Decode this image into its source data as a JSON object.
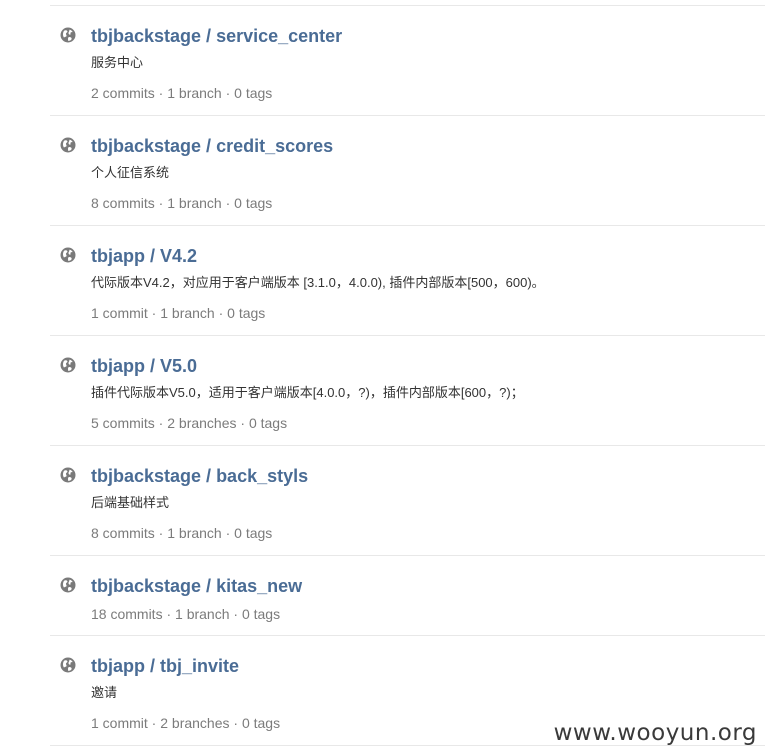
{
  "repos": [
    {
      "owner": "tbjbackstage",
      "separator": "/",
      "name": "service_center",
      "description": "服务中心",
      "meta": "2 commits · 1 branch · 0 tags",
      "icon": "globe-icon"
    },
    {
      "owner": "tbjbackstage",
      "separator": "/",
      "name": "credit_scores",
      "description": "个人征信系统",
      "meta": "8 commits · 1 branch · 0 tags",
      "icon": "globe-icon"
    },
    {
      "owner": "tbjapp",
      "separator": "/",
      "name": "V4.2",
      "description": "代际版本V4.2，对应用于客户端版本 [3.1.0，4.0.0), 插件内部版本[500，600)。",
      "meta": "1 commit · 1 branch · 0 tags",
      "icon": "globe-icon"
    },
    {
      "owner": "tbjapp",
      "separator": "/",
      "name": "V5.0",
      "description": "插件代际版本V5.0，适用于客户端版本[4.0.0，?)，插件内部版本[600，?)；",
      "meta": "5 commits · 2 branches · 0 tags",
      "icon": "globe-icon"
    },
    {
      "owner": "tbjbackstage",
      "separator": "/",
      "name": "back_styls",
      "description": "后端基础样式",
      "meta": "8 commits · 1 branch · 0 tags",
      "icon": "globe-icon"
    },
    {
      "owner": "tbjbackstage",
      "separator": "/",
      "name": "kitas_new",
      "description": "",
      "meta": "18 commits · 1 branch · 0 tags",
      "icon": "globe-icon"
    },
    {
      "owner": "tbjapp",
      "separator": "/",
      "name": "tbj_invite",
      "description": "邀请",
      "meta": "1 commit · 2 branches · 0 tags",
      "icon": "globe-icon"
    }
  ],
  "watermark": "www.wooyun.org",
  "colors": {
    "link": "#4a6c95",
    "meta": "#7b7b7b",
    "icon": "#7a7a7a",
    "divider": "#e8e8e8"
  }
}
